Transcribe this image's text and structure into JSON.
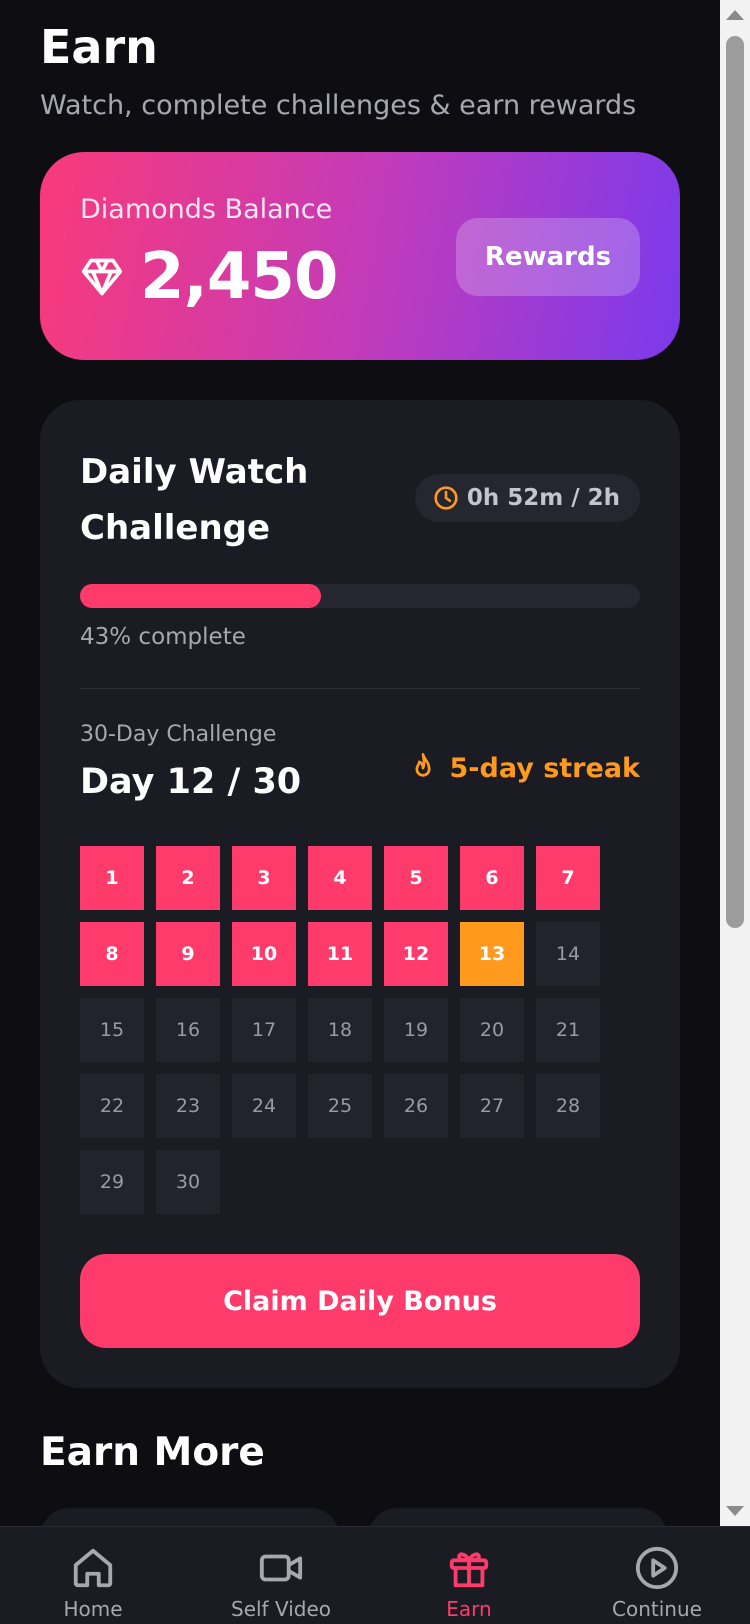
{
  "header": {
    "title": "Earn",
    "subtitle": "Watch, complete challenges & earn rewards"
  },
  "balance": {
    "label": "Diamonds Balance",
    "value": "2,450",
    "rewards_label": "Rewards",
    "icon": "diamond-icon"
  },
  "daily_watch": {
    "title": "Daily Watch Challenge",
    "timer": "0h 52m / 2h",
    "progress_percent": 43,
    "progress_text": "43% complete"
  },
  "thirty_day": {
    "label": "30-Day Challenge",
    "day_text": "Day 12 / 30",
    "streak_text": "5-day streak",
    "completed_through": 12,
    "today": 13,
    "total": 30,
    "days": [
      "1",
      "2",
      "3",
      "4",
      "5",
      "6",
      "7",
      "8",
      "9",
      "10",
      "11",
      "12",
      "13",
      "14",
      "15",
      "16",
      "17",
      "18",
      "19",
      "20",
      "21",
      "22",
      "23",
      "24",
      "25",
      "26",
      "27",
      "28",
      "29",
      "30"
    ]
  },
  "claim_label": "Claim Daily Bonus",
  "earn_more": {
    "title": "Earn More"
  },
  "nav": {
    "items": [
      {
        "label": "Home",
        "icon": "home-icon"
      },
      {
        "label": "Self Video",
        "icon": "video-icon"
      },
      {
        "label": "Earn",
        "icon": "gift-icon"
      },
      {
        "label": "Continue",
        "icon": "play-circle-icon"
      }
    ],
    "active_index": 2
  },
  "colors": {
    "background": "#0e0e12",
    "card": "#1b1b23",
    "accent": "#ff3b6b",
    "orange": "#ff9a1f",
    "gradient_start": "#fa3a79",
    "gradient_end": "#7b3aec"
  }
}
